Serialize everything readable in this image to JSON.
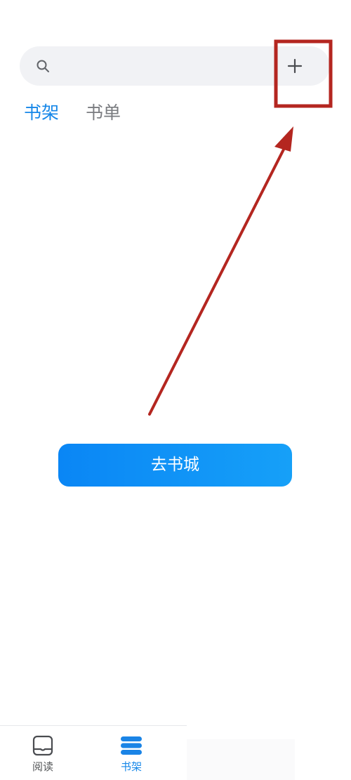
{
  "search": {
    "placeholder": ""
  },
  "header": {
    "add_label": "+"
  },
  "tabs": [
    {
      "label": "书架",
      "active": true
    },
    {
      "label": "书单",
      "active": false
    }
  ],
  "main": {
    "cta_label": "去书城"
  },
  "bottom_nav": {
    "items": [
      {
        "label": "阅读",
        "icon": "reader-icon",
        "active": false
      },
      {
        "label": "书架",
        "icon": "bookshelf-icon",
        "active": true
      }
    ]
  },
  "icons": {
    "search": "search-icon",
    "add": "plus-icon"
  },
  "colors": {
    "accent": "#1687e8",
    "button_gradient_start": "#0a86f5",
    "button_gradient_end": "#16a0f8",
    "annotation": "#b42620",
    "inactive_text": "#7a7c80"
  }
}
